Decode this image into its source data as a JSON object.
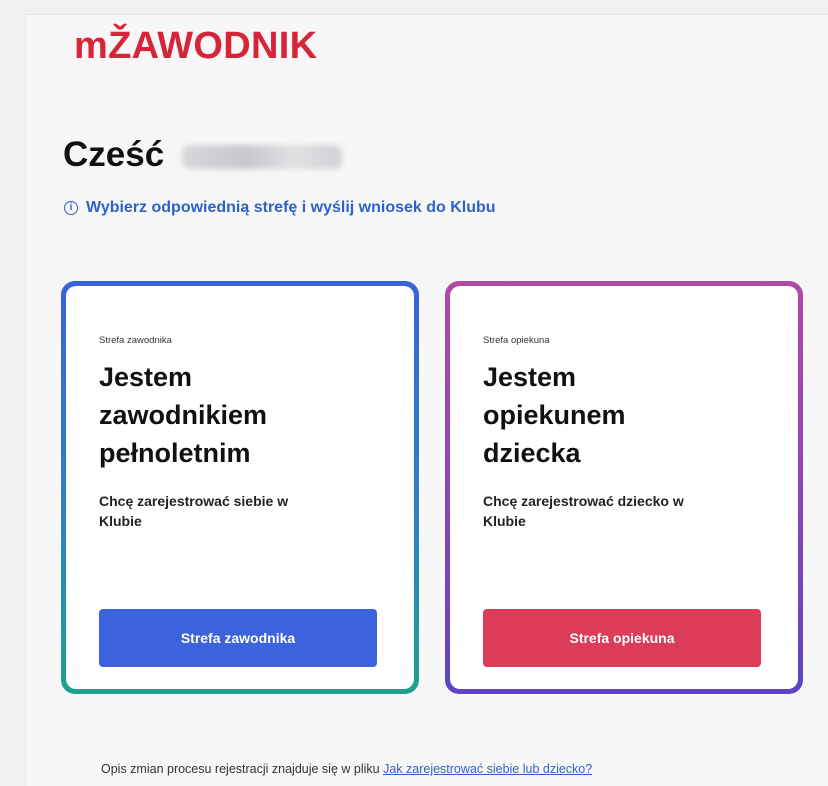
{
  "brand": {
    "logo_text": "mŽAWODNIK",
    "logo_color": "#d62439"
  },
  "greeting": {
    "word": "Cześć"
  },
  "hint": {
    "icon": "info-icon",
    "text": "Wybierz odpowiednią strefę i wyślij wniosek do Klubu"
  },
  "cards": [
    {
      "tag": "Strefa zawodnika",
      "title": "Jestem\nzawodnikiem\npełnoletnim",
      "description": "Chcę zarejestrować siebie w\nKlubie",
      "button_label": "Strefa zawodnika",
      "button_color": "#3d63dc"
    },
    {
      "tag": "Strefa opiekuna",
      "title": "Jestem\nopiekunem\ndziecka",
      "description": "Chcę zarejestrować dziecko w\nKlubie",
      "button_label": "Strefa opiekuna",
      "button_color": "#dd3b5a"
    }
  ],
  "footer": {
    "text": "Opis zmian procesu rejestracji znajduje się w pliku",
    "link_text": "Jak zarejestrować siebie lub dziecko?"
  }
}
